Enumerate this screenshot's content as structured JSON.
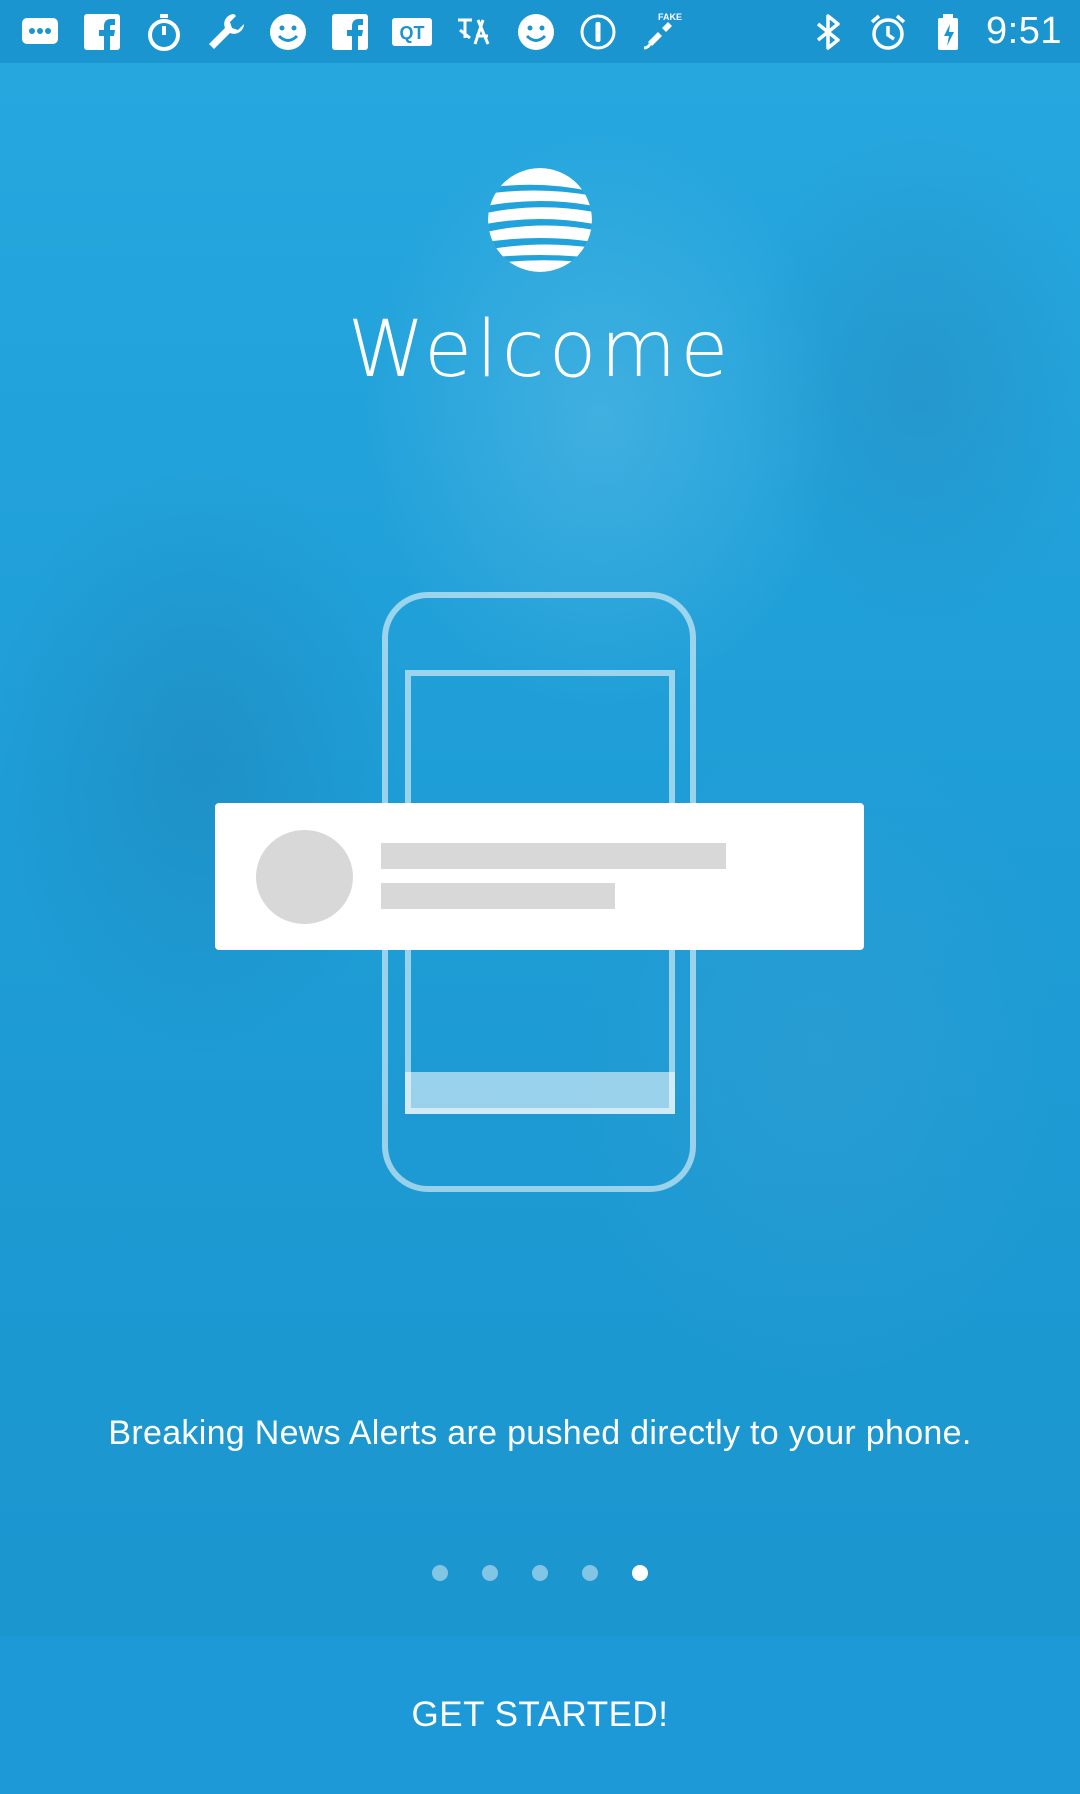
{
  "status_bar": {
    "time": "9:51",
    "left_icons": [
      "chat-bubble-icon",
      "facebook-icon",
      "stopwatch-icon",
      "wrench-icon",
      "smiley-icon",
      "facebook-icon",
      "qt-icon",
      "translate-icon",
      "smiley-icon",
      "info-circle-icon",
      "fake-gps-icon"
    ],
    "right_icons": [
      "bluetooth-icon",
      "alarm-icon",
      "battery-icon"
    ],
    "qt_label": "QT",
    "fake_label": "FAKE"
  },
  "onboarding": {
    "title": "Welcome",
    "caption": "Breaking News Alerts are pushed directly to your phone.",
    "page_count": 5,
    "active_page": 5
  },
  "cta": {
    "label": "GET STARTED!"
  },
  "colors": {
    "background": "#21a2da",
    "button": "#1c99d6",
    "card": "#ffffff",
    "placeholder": "#d8d8d8"
  }
}
